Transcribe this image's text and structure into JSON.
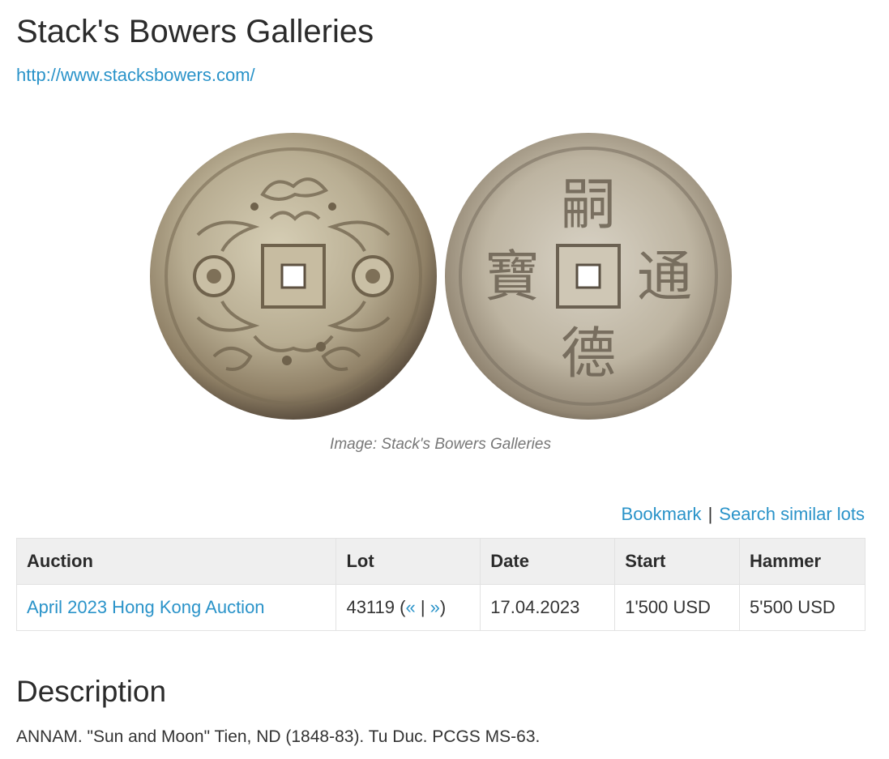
{
  "header": {
    "title": "Stack's Bowers Galleries",
    "url": "http://www.stacksbowers.com/"
  },
  "image": {
    "caption": "Image: Stack's Bowers Galleries",
    "obverse_glyph": "",
    "reverse_glyphs": [
      "嗣",
      "通",
      "德",
      "寶"
    ]
  },
  "actions": {
    "bookmark": "Bookmark",
    "separator": "|",
    "search_similar": "Search similar lots"
  },
  "table": {
    "headers": [
      "Auction",
      "Lot",
      "Date",
      "Start",
      "Hammer"
    ],
    "row": {
      "auction": "April 2023 Hong Kong Auction",
      "lot_number": "43119",
      "lot_open_paren": " (",
      "prev": "«",
      "lot_sep": " | ",
      "next": "»",
      "lot_close_paren": ")",
      "date": "17.04.2023",
      "start": "1'500 USD",
      "hammer": "5'500 USD"
    }
  },
  "description": {
    "heading": "Description",
    "text": "ANNAM. \"Sun and Moon\" Tien, ND (1848-83). Tu Duc. PCGS MS-63."
  },
  "colors": {
    "link": "#2a93c9",
    "header_bg": "#efefef",
    "coin_base": "#b8ad92"
  }
}
